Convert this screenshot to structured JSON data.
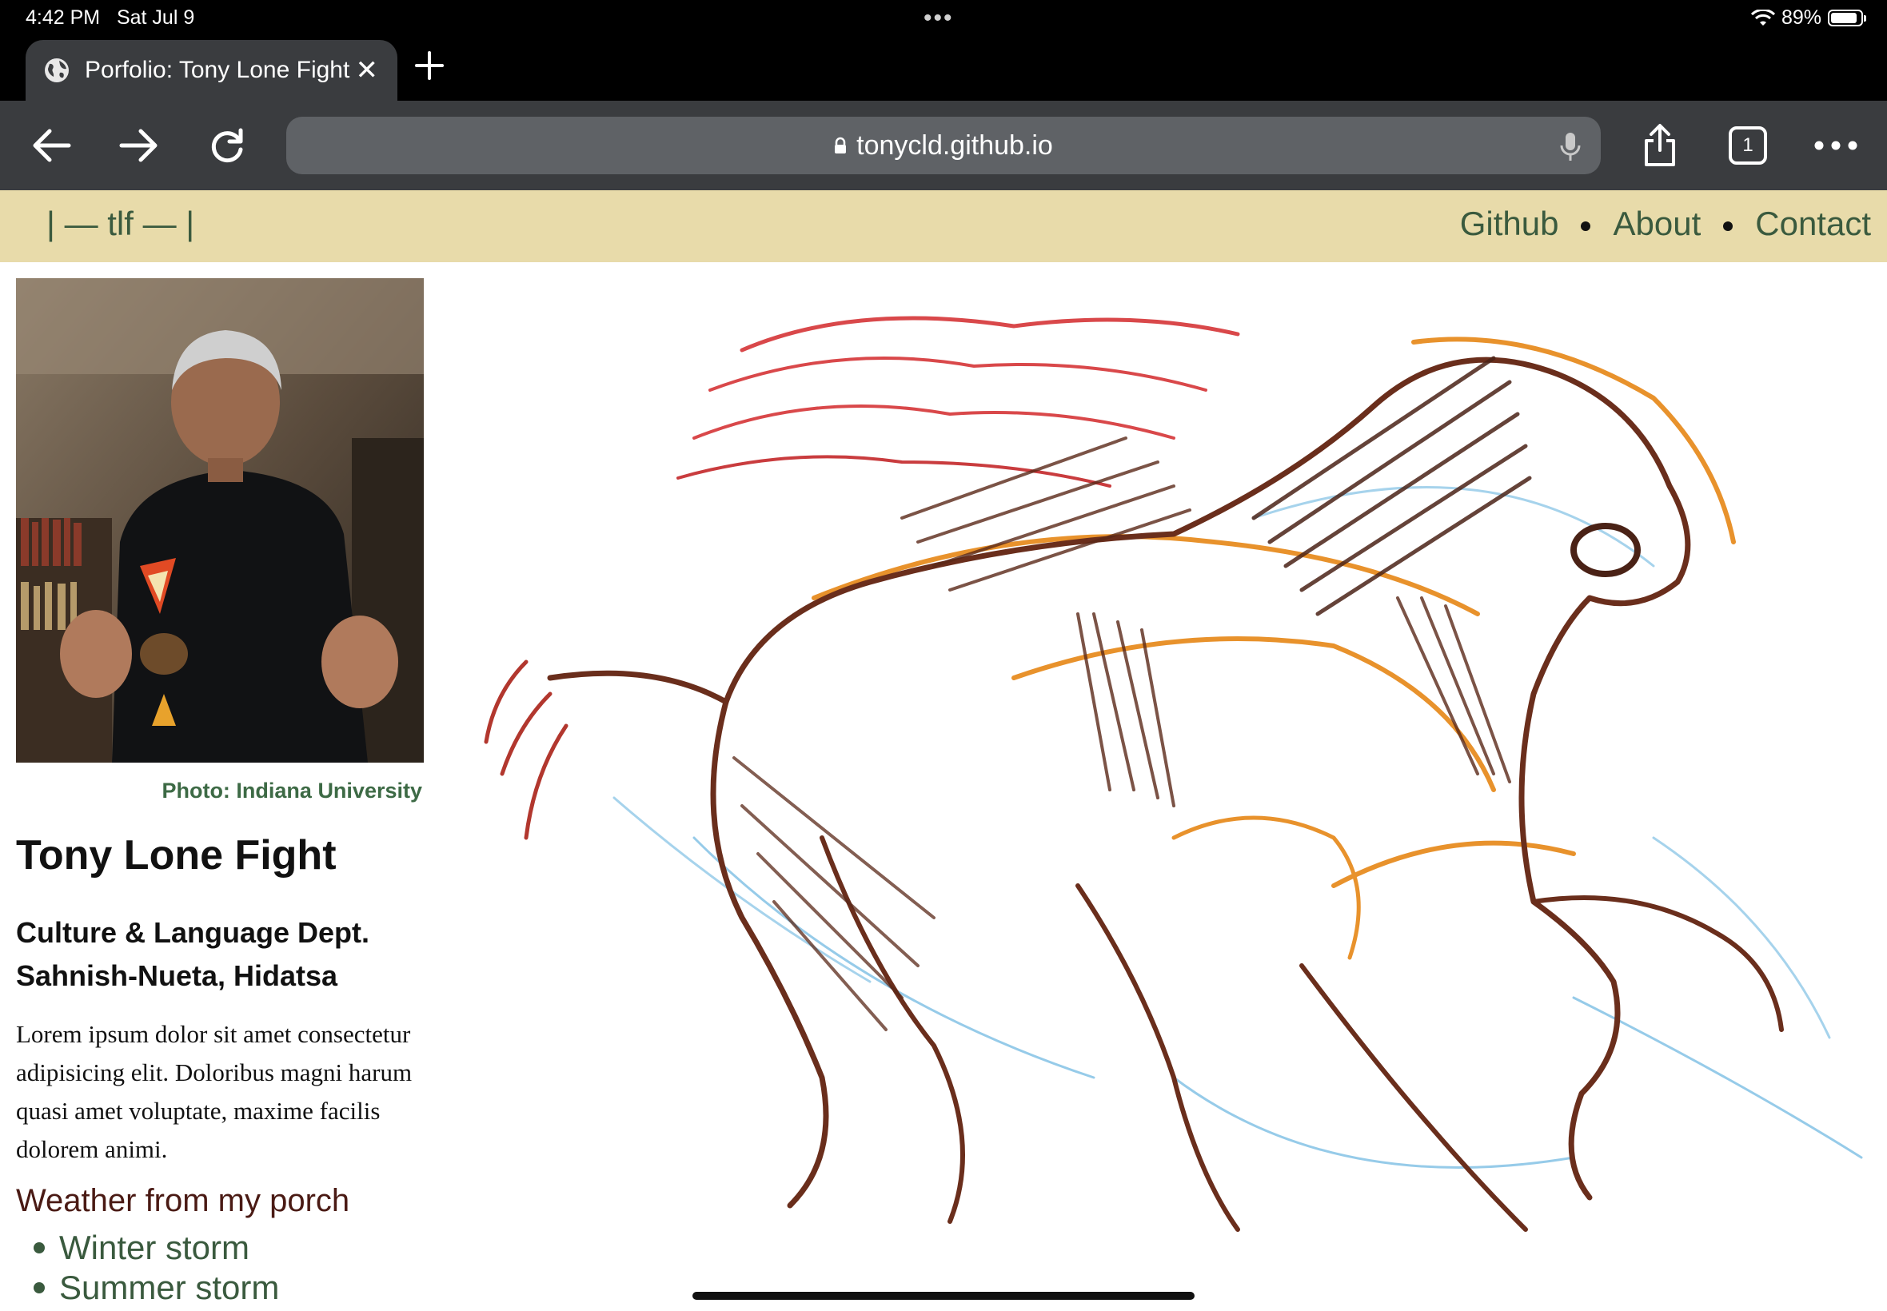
{
  "status_bar": {
    "time": "4:42 PM",
    "date": "Sat Jul 9",
    "battery": "89%",
    "battery_level": 0.89
  },
  "browser": {
    "tab_title": "Porfolio: Tony Lone Fight",
    "tab_count": "1",
    "url": "tonycld.github.io"
  },
  "site": {
    "logo": "| — tlf — |",
    "nav": [
      "Github",
      "About",
      "Contact"
    ]
  },
  "profile": {
    "caption": "Photo: Indiana University",
    "name": "Tony Lone Fight",
    "dept_line1": "Culture & Language Dept.",
    "dept_line2": "Sahnish-Nueta, Hidatsa",
    "bio": "Lorem ipsum dolor sit amet consectetur adipisicing elit. Doloribus magni harum quasi amet voluptate, maxime facilis dolorem animi.",
    "weather_title": "Weather from my porch",
    "weather_items": [
      "Winter storm",
      "Summer storm"
    ]
  },
  "colors": {
    "header_bg": "#e8dbaa",
    "link_green": "#3a5a3e",
    "browser_chrome": "#3a3c3f"
  }
}
